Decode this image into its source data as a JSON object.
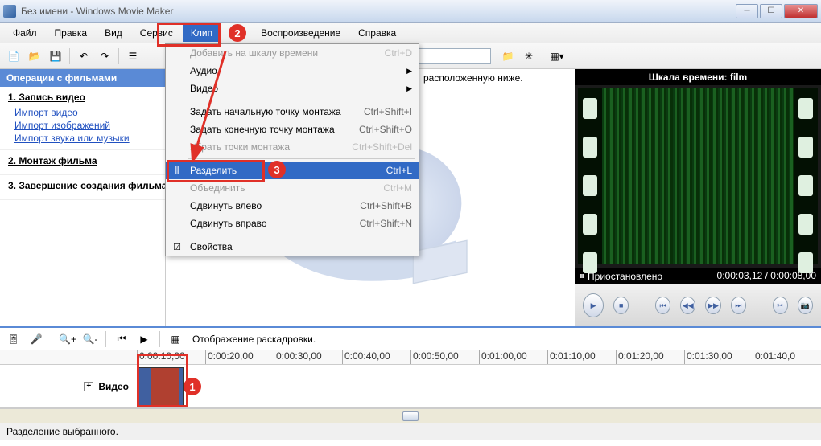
{
  "window": {
    "title": "Без имени - Windows Movie Maker"
  },
  "menubar": [
    "Файл",
    "Правка",
    "Вид",
    "Сервис",
    "Клип",
    "Воспроизведение",
    "Справка"
  ],
  "menubar_active_index": 4,
  "dropdown": {
    "items": [
      {
        "label": "Добавить на шкалу времени",
        "shortcut": "Ctrl+D",
        "disabled": true
      },
      {
        "label": "Аудио",
        "submenu": true
      },
      {
        "label": "Видео",
        "submenu": true
      },
      {
        "sep": true
      },
      {
        "label": "Задать начальную точку монтажа",
        "shortcut": "Ctrl+Shift+I"
      },
      {
        "label": "Задать конечную точку монтажа",
        "shortcut": "Ctrl+Shift+O"
      },
      {
        "label": "Убрать точки монтажа",
        "shortcut": "Ctrl+Shift+Del",
        "disabled": true
      },
      {
        "sep": true
      },
      {
        "label": "Разделить",
        "shortcut": "Ctrl+L",
        "highlighted": true,
        "icon": "split"
      },
      {
        "label": "Объединить",
        "shortcut": "Ctrl+M",
        "disabled": true
      },
      {
        "label": "Сдвинуть влево",
        "shortcut": "Ctrl+Shift+B"
      },
      {
        "label": "Сдвинуть вправо",
        "shortcut": "Ctrl+Shift+N"
      },
      {
        "sep": true
      },
      {
        "label": "Свойства",
        "icon": "props"
      }
    ]
  },
  "taskpane": {
    "header": "Операции с фильмами",
    "sections": [
      {
        "title": "1. Запись видео",
        "links": [
          "Импорт видео",
          "Импорт изображений",
          "Импорт звука или музыки"
        ]
      },
      {
        "title": "2. Монтаж фильма",
        "links": []
      },
      {
        "title": "3. Завершение создания фильма",
        "links": []
      }
    ]
  },
  "center": {
    "help_hint": "расположенную ниже."
  },
  "preview": {
    "title": "Шкала времени: film",
    "status": "Приостановлено",
    "time": "0:00:03,12 / 0:00:08,00"
  },
  "timeline": {
    "toolbar_text": "Отображение раскадровки.",
    "track_label": "Видео",
    "marks": [
      "0:00:10,00",
      "0:00:20,00",
      "0:00:30,00",
      "0:00:40,00",
      "0:00:50,00",
      "0:01:00,00",
      "0:01:10,00",
      "0:01:20,00",
      "0:01:30,00",
      "0:01:40,0"
    ]
  },
  "statusbar": "Разделение выбранного."
}
